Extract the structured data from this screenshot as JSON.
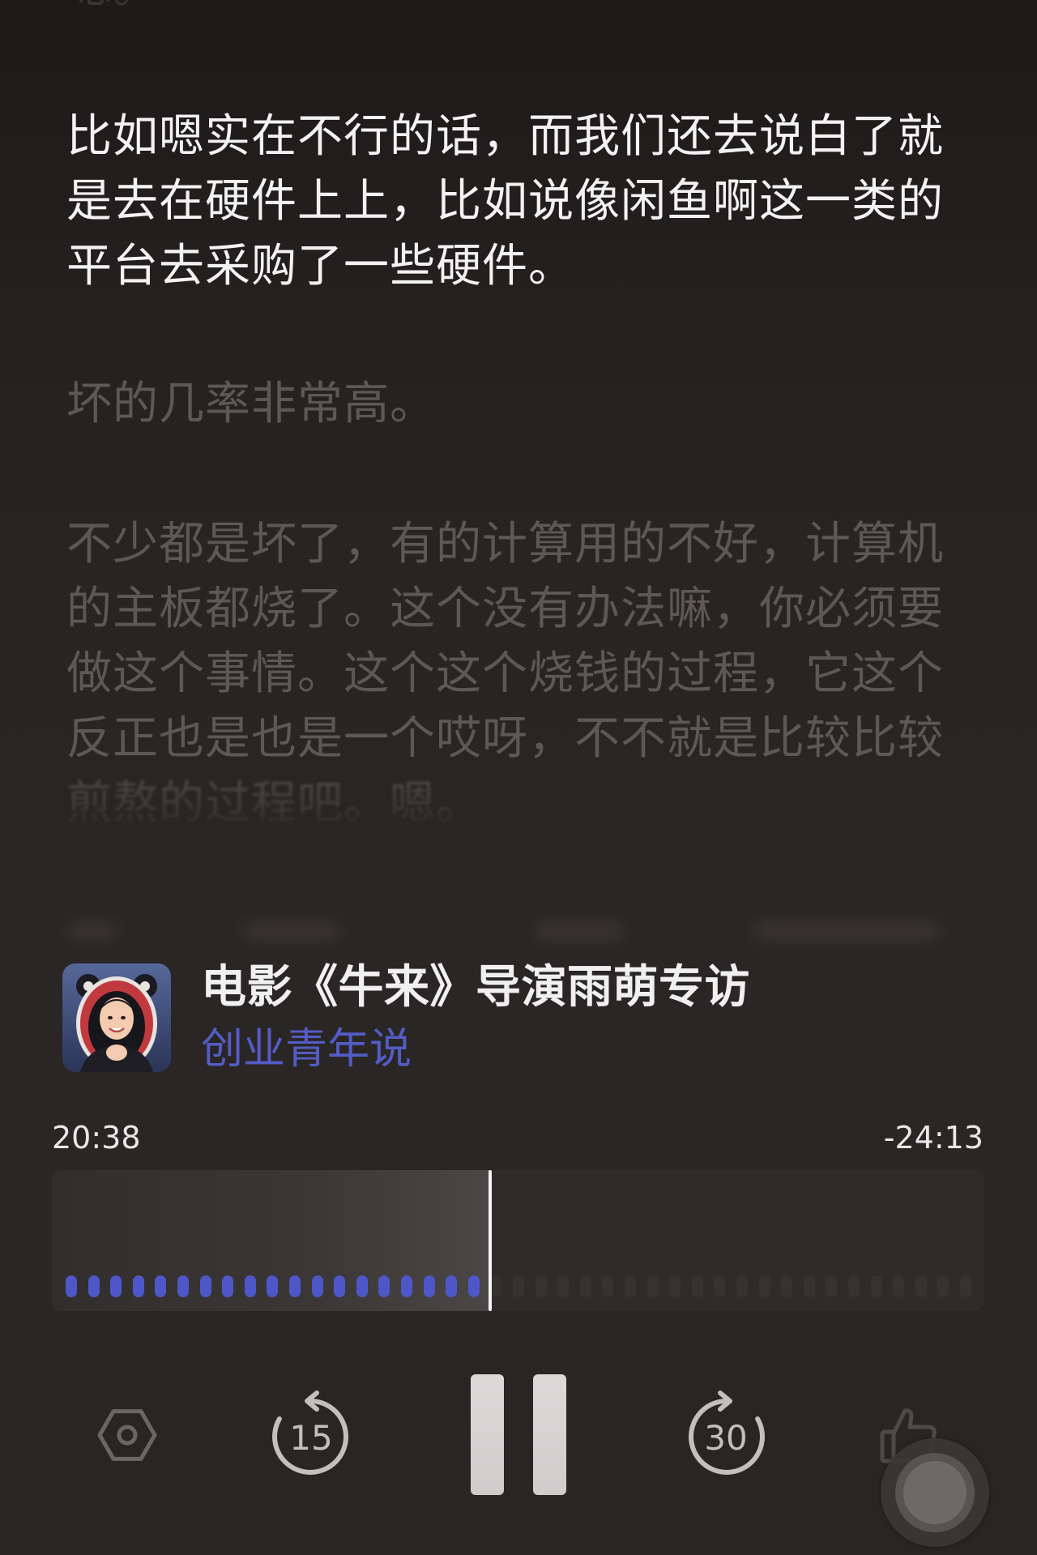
{
  "transcript": {
    "previous_line": "嗯。",
    "paragraphs": [
      {
        "highlighted": true,
        "lines": [
          "比如嗯实在不行的话，而我们还去说白了就",
          "是去在硬件上上，比如说像闲鱼啊这一类的",
          "平台去采购了一些硬件。"
        ]
      },
      {
        "highlighted": false,
        "lines": [
          "坏的几率非常高。"
        ]
      },
      {
        "highlighted": false,
        "lines": [
          "不少都是坏了，有的计算用的不好，计算机",
          "的主板都烧了。这个没有办法嘛，你必须要",
          "做这个事情。这个这个烧钱的过程，它这个",
          "反正也是也是一个哎呀，不不就是比较比较",
          "煎熬的过程吧。嗯。"
        ]
      }
    ]
  },
  "episode": {
    "title": "电影《牛来》导演雨萌专访",
    "podcast": "创业青年说",
    "cover_icon": "podcast-cover-art"
  },
  "player": {
    "elapsed": "20:38",
    "remaining": "-24:13",
    "progress": 0.47,
    "is_playing": true
  },
  "controls": {
    "settings_icon": "hexagon-settings-icon",
    "rewind": {
      "icon": "rewind-icon",
      "seconds": "15"
    },
    "play_pause_icon": "pause-icon",
    "forward": {
      "icon": "forward-icon",
      "seconds": "30"
    },
    "like_icon": "thumbs-up-icon",
    "assistive_touch_icon": "assistive-touch-icon"
  },
  "colors": {
    "background": "#272322",
    "text_primary": "#f2f2f2",
    "text_dim": "#5d5856",
    "accent": "#545cc6",
    "played_dot": "#4f57c8",
    "unplayed_dot": "#363231"
  }
}
